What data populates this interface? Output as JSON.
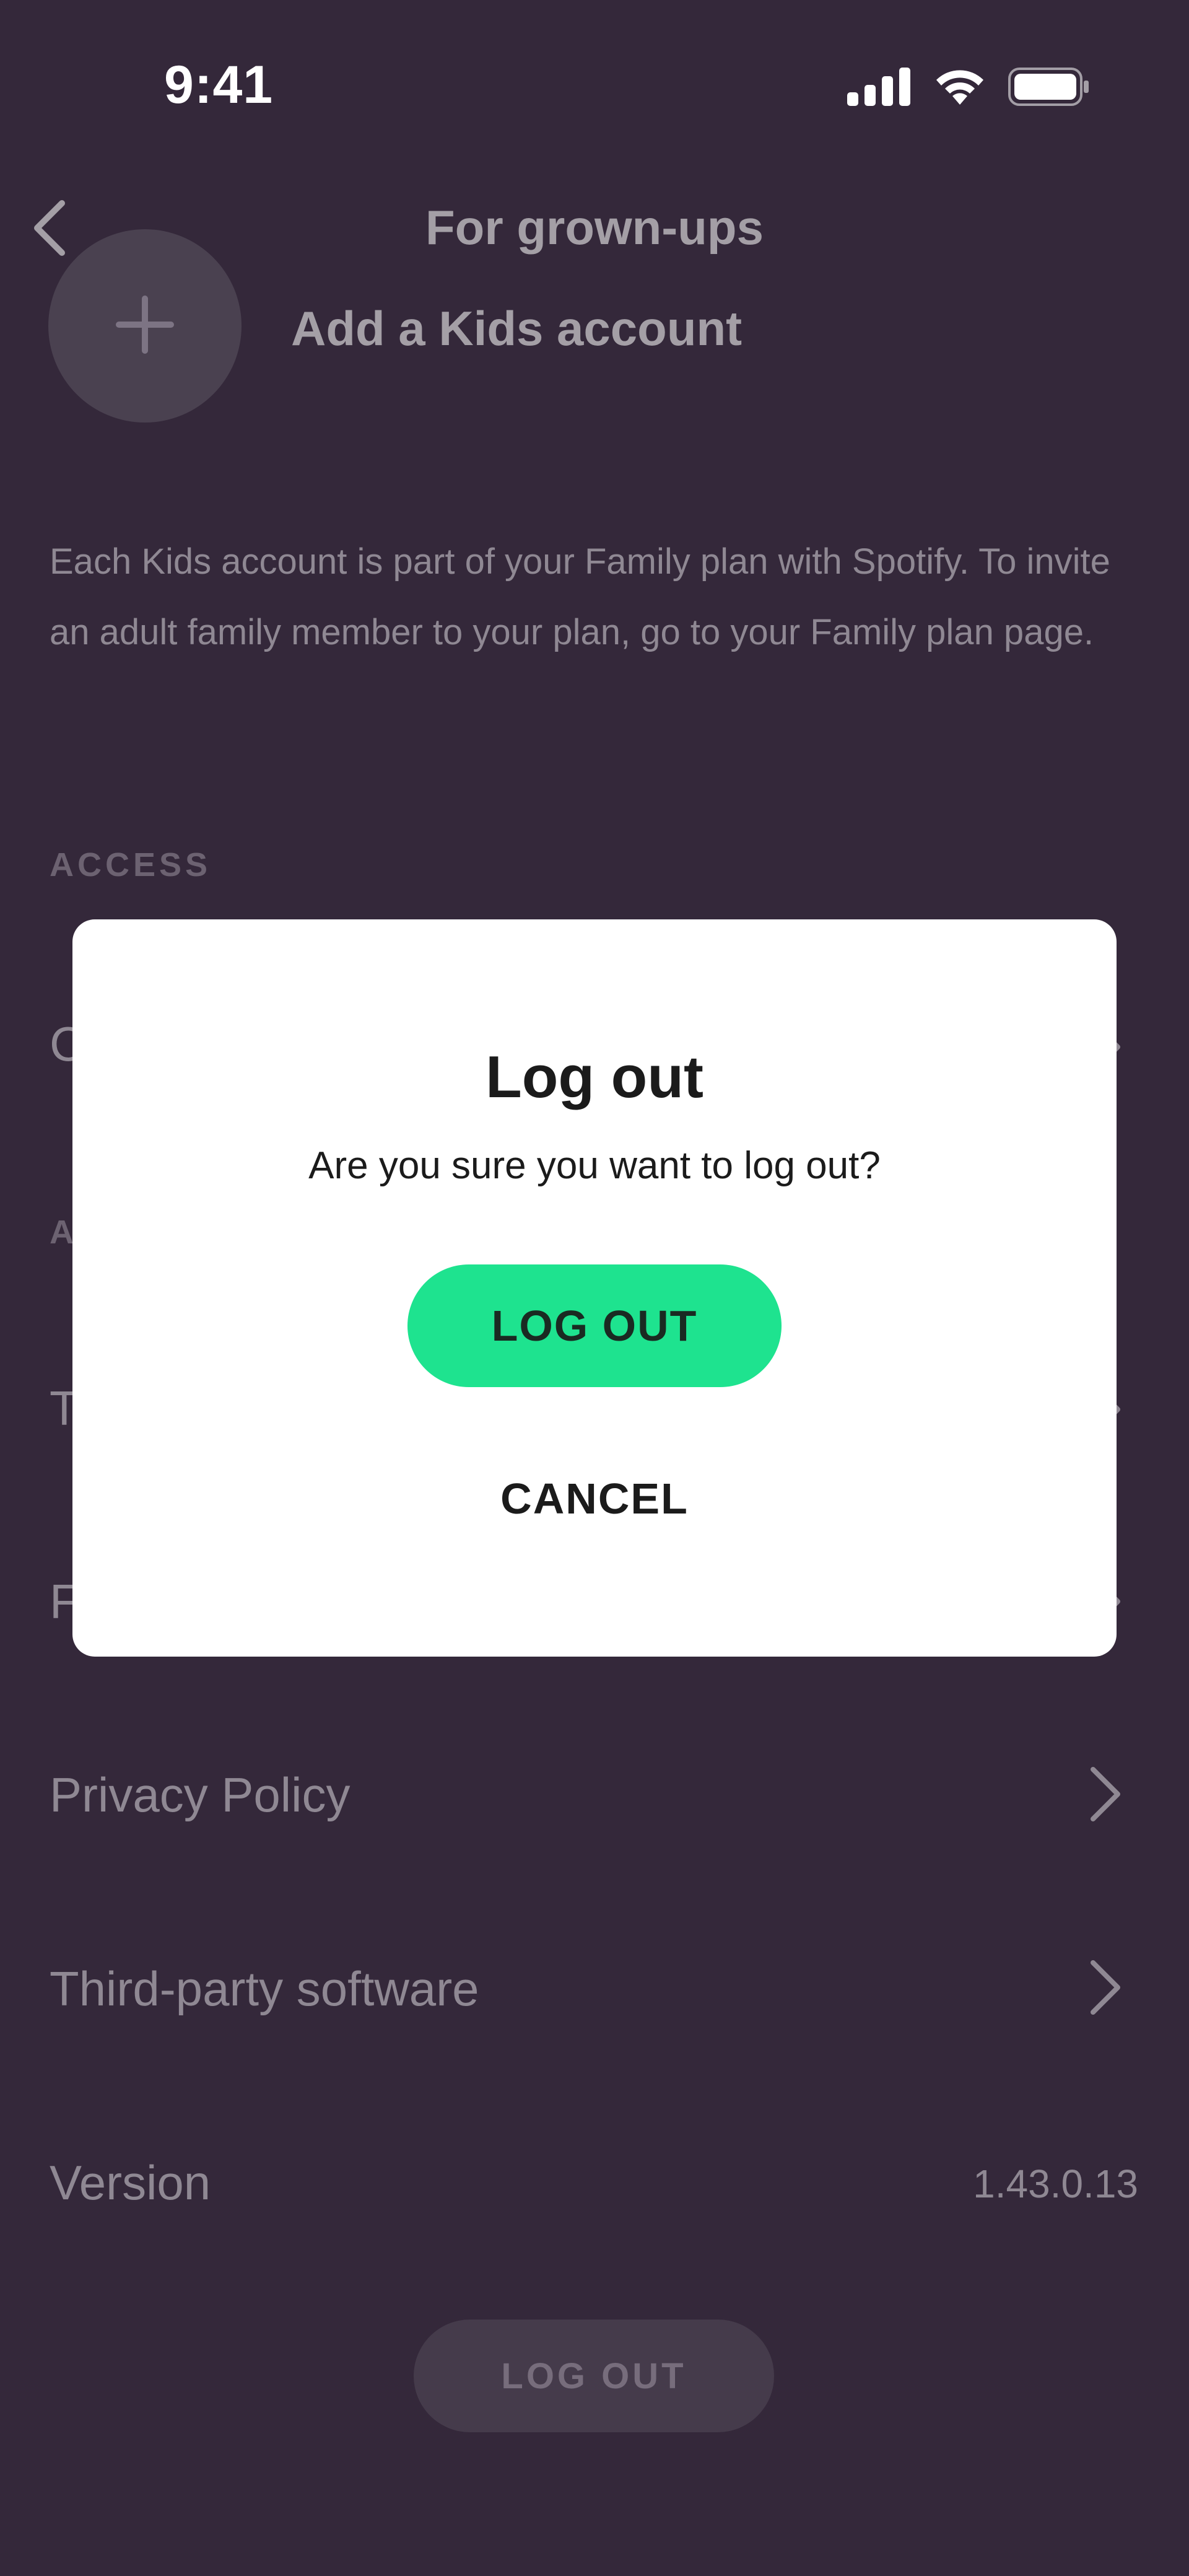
{
  "status_bar": {
    "time": "9:41",
    "icons": [
      "cellular-signal-icon",
      "wifi-icon",
      "battery-icon"
    ]
  },
  "header": {
    "title": "For grown-ups",
    "back_icon": "chevron-left-icon"
  },
  "add_kids": {
    "label": "Add a Kids account",
    "icon": "plus-icon"
  },
  "info_text": "Each Kids account is part of your Family plan with Spotify. To invite an adult family member to your plan, go to your Family plan page.",
  "sections": {
    "access_label": "ACCESS",
    "access_first_letter": "C",
    "about_letter": "A",
    "row_t_letter": "T",
    "row_f_letter": "F"
  },
  "rows": {
    "privacy_policy": "Privacy Policy",
    "third_party": "Third-party software",
    "version_label": "Version",
    "version_value": "1.43.0.13"
  },
  "bottom_button": {
    "label": "LOG OUT"
  },
  "modal": {
    "title": "Log out",
    "message": "Are you sure you want to log out?",
    "confirm_label": "LOG OUT",
    "cancel_label": "CANCEL"
  },
  "colors": {
    "background": "#34283a",
    "accent_green": "#1ee38f",
    "modal_bg": "#ffffff"
  }
}
